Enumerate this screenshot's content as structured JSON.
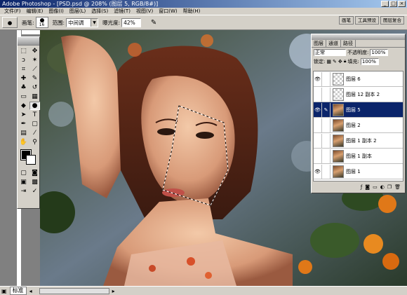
{
  "window": {
    "title": "Adobe Photoshop - [PSD.psd @ 208% (图层 5, RGB/8#)]",
    "controls": [
      "_",
      "□",
      "×"
    ]
  },
  "menu": [
    "文件(F)",
    "编辑(E)",
    "图像(I)",
    "图层(L)",
    "选择(S)",
    "滤镜(T)",
    "视图(V)",
    "窗口(W)",
    "帮助(H)"
  ],
  "options": {
    "brush_label": "画笔:",
    "brush_size": "16",
    "range_label": "范围:",
    "range_value": "中间调",
    "exposure_label": "曝光度:",
    "exposure_value": "42%",
    "palette_tabs": [
      "画笔",
      "工具预设",
      "图层复合"
    ]
  },
  "layers_panel": {
    "tabs": [
      "图层",
      "通道",
      "路径"
    ],
    "blend_mode": "正常",
    "opacity_label": "不透明度:",
    "opacity_value": "100%",
    "lock_label": "锁定:",
    "fill_label": "填充:",
    "fill_value": "100%",
    "layers": [
      {
        "name": "图层 6",
        "visible": true,
        "thumb": "transparent",
        "selected": false
      },
      {
        "name": "图层 12 副本 2",
        "visible": false,
        "thumb": "transparent",
        "selected": false
      },
      {
        "name": "图层 5",
        "visible": true,
        "thumb": "photo",
        "selected": true
      },
      {
        "name": "图层 2",
        "visible": false,
        "thumb": "photo",
        "selected": false
      },
      {
        "name": "图层 1 副本 2",
        "visible": false,
        "thumb": "photo",
        "selected": false
      },
      {
        "name": "图层 1 副本",
        "visible": false,
        "thumb": "photo",
        "selected": false
      },
      {
        "name": "图层 1",
        "visible": true,
        "thumb": "photo",
        "selected": false
      }
    ]
  },
  "statusbar": {
    "mode_label": "标准"
  },
  "colors": {
    "foreground": "#000000",
    "background": "#ffffff",
    "selection": "#0a246a"
  }
}
